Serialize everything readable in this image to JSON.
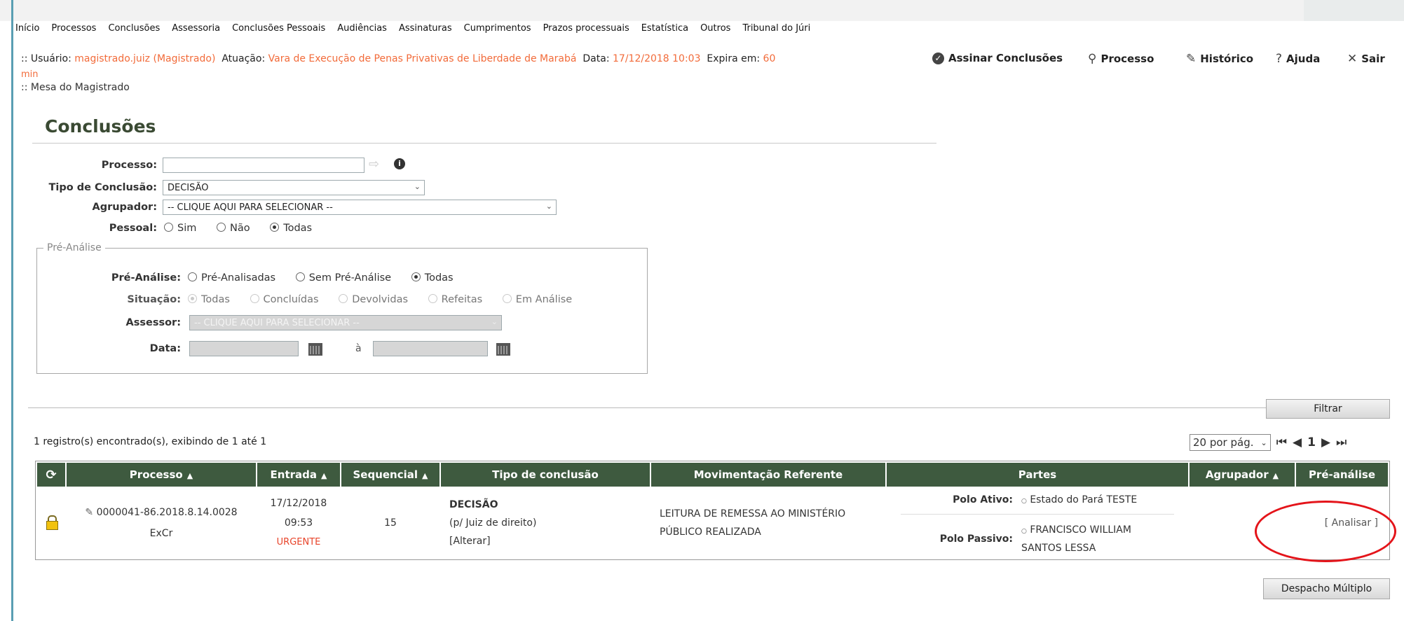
{
  "menu": [
    "Início",
    "Processos",
    "Conclusões",
    "Assessoria",
    "Conclusões Pessoais",
    "Audiências",
    "Assinaturas",
    "Cumprimentos",
    "Prazos processuais",
    "Estatística",
    "Outros",
    "Tribunal do Júri"
  ],
  "header": {
    "user_label": ":: Usuário:",
    "user_value": "magistrado.juiz (Magistrado)",
    "atuacao_label": "Atuação:",
    "atuacao_value": "Vara de Execução de Penas Privativas de Liberdade de Marabá",
    "data_label": "Data:",
    "data_value": "17/12/2018 10:03",
    "expira_label": "Expira em:",
    "expira_value": "60",
    "expira_unit": "min",
    "breadcrumb": ":: Mesa do Magistrado",
    "actions": {
      "assinar": "Assinar Conclusões",
      "processo": "Processo",
      "historico": "Histórico",
      "ajuda": "Ajuda",
      "sair": "Sair"
    }
  },
  "page_title": "Conclusões",
  "filters": {
    "processo_label": "Processo:",
    "processo_value": "",
    "tipo_label": "Tipo de Conclusão:",
    "tipo_value": "DECISÃO",
    "agrupador_label": "Agrupador:",
    "agrupador_value": "-- CLIQUE AQUI PARA SELECIONAR --",
    "pessoal_label": "Pessoal:",
    "pessoal_options": [
      "Sim",
      "Não",
      "Todas"
    ],
    "pessoal_selected": "Todas"
  },
  "pre_analise": {
    "legend": "Pré-Análise",
    "pre_label": "Pré-Análise:",
    "pre_options": [
      "Pré-Analisadas",
      "Sem Pré-Análise",
      "Todas"
    ],
    "pre_selected": "Todas",
    "situacao_label": "Situação:",
    "situacao_options": [
      "Todas",
      "Concluídas",
      "Devolvidas",
      "Refeitas",
      "Em Análise"
    ],
    "situacao_selected": "Todas",
    "assessor_label": "Assessor:",
    "assessor_value": "-- CLIQUE AQUI PARA SELECIONAR --",
    "data_label": "Data:",
    "data_sep": "à"
  },
  "filtrar_button": "Filtrar",
  "result_count": "1 registro(s) encontrado(s), exibindo de 1 até 1",
  "pager": {
    "per_page": "20 por pág.",
    "current_page": "1"
  },
  "table": {
    "headers": [
      "Processo",
      "Entrada",
      "Sequencial",
      "Tipo de conclusão",
      "Movimentação Referente",
      "Partes",
      "Agrupador",
      "Pré-análise"
    ],
    "row": {
      "processo_num": "0000041-86.2018.8.14.0028",
      "processo_classe": "ExCr",
      "entrada_data": "17/12/2018",
      "entrada_hora": "09:53",
      "entrada_flag": "URGENTE",
      "sequencial": "15",
      "tipo": "DECISÃO",
      "tipo_sub": "(p/ Juiz de direito)",
      "tipo_alterar": "[Alterar]",
      "movimentacao": "LEITURA DE REMESSA AO MINISTÉRIO PÚBLICO REALIZADA",
      "polo_ativo_label": "Polo Ativo:",
      "polo_ativo_value": "Estado do Pará TESTE",
      "polo_passivo_label": "Polo Passivo:",
      "polo_passivo_value": "FRANCISCO WILLIAM SANTOS LESSA",
      "agrupador": "",
      "pre_analise_link": "[ Analisar ]"
    }
  },
  "despacho_button": "Despacho Múltiplo",
  "colors": {
    "table_header": "#3e5a3f",
    "orange_text": "#f26b3a",
    "urgent": "#e8442a",
    "highlight_circle": "#e4141a"
  }
}
